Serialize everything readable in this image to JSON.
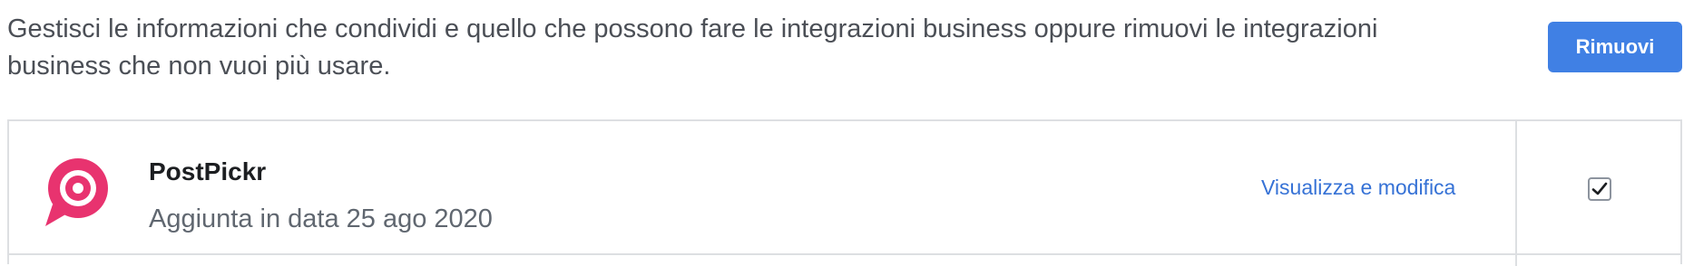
{
  "intro_text": "Gestisci le informazioni che condividi e quello che possono fare le integrazioni business oppure rimuovi le integrazioni business che non vuoi più usare.",
  "remove_button_label": "Rimuovi",
  "accent_color": "#4080e4",
  "integrations": [
    {
      "name": "PostPickr",
      "added_date": "Aggiunta in data 25 ago 2020",
      "view_edit_label": "Visualizza e modifica",
      "icon": "postpickr-logo-icon",
      "icon_color": "#e8336f",
      "selected": true
    }
  ]
}
